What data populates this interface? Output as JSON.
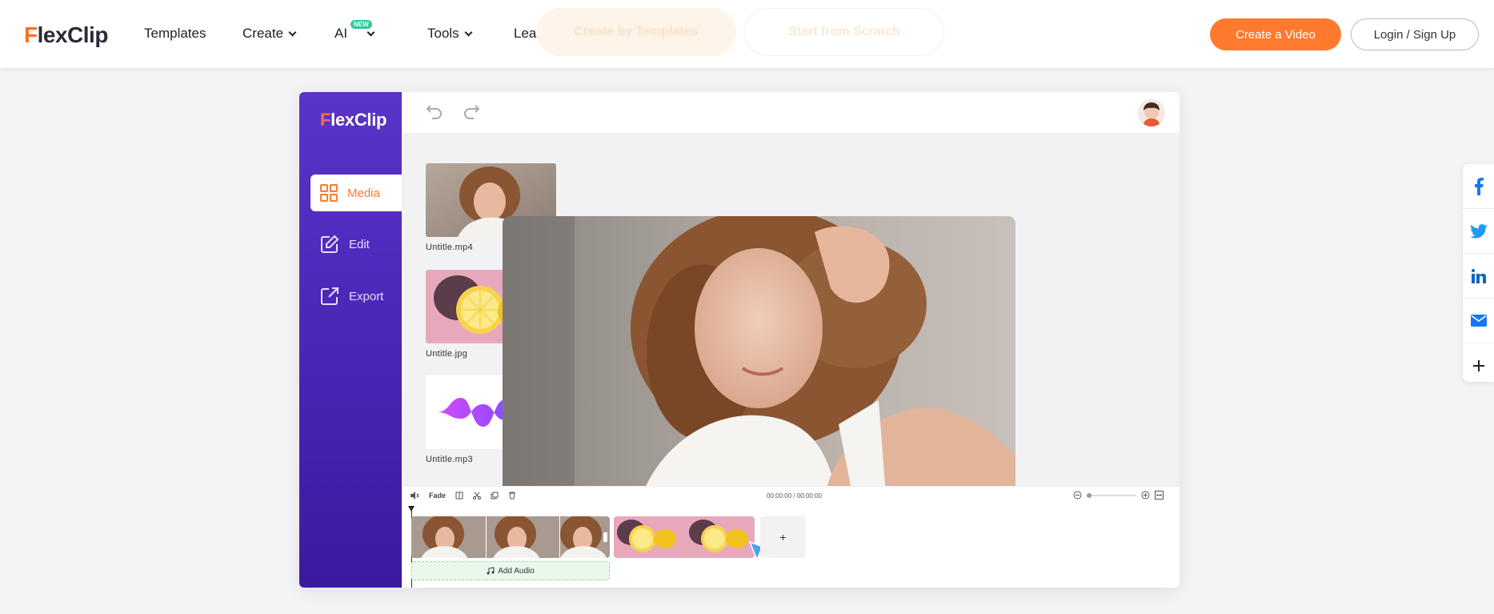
{
  "nav": {
    "logo_f": "F",
    "logo_rest": "lexClip",
    "items": [
      {
        "label": "Templates"
      },
      {
        "label": "Create"
      },
      {
        "label": "AI"
      },
      {
        "label": "Tools"
      },
      {
        "label": "Learn"
      }
    ],
    "ai_badge": "NEW",
    "ghost_buttons": [
      "Create by Templates",
      "Start from Scratch"
    ],
    "create_video": "Create a Video",
    "login": "Login / Sign Up"
  },
  "share": [
    "facebook-icon",
    "twitter-icon",
    "linkedin-icon",
    "mail-icon",
    "plus-icon"
  ],
  "editor": {
    "logo_f": "F",
    "logo_rest": "lexClip",
    "sidebar": [
      {
        "label": "Media",
        "active": true
      },
      {
        "label": "Edit",
        "active": false
      },
      {
        "label": "Export",
        "active": false
      }
    ],
    "media": [
      {
        "label": "Untitle.mp4"
      },
      {
        "label": "Untitle.jpg"
      },
      {
        "label": "Untitle.mp3"
      }
    ],
    "timeline": {
      "fade": "Fade",
      "time": "00:00:00 / 00:00:00",
      "add": "+",
      "add_audio": "Add Audio"
    }
  },
  "colors": {
    "accent": "#ff7a2e",
    "sidebar_top": "#5a34c8",
    "sidebar_bottom": "#3c1a9e",
    "new_badge": "#2ecc9a"
  }
}
